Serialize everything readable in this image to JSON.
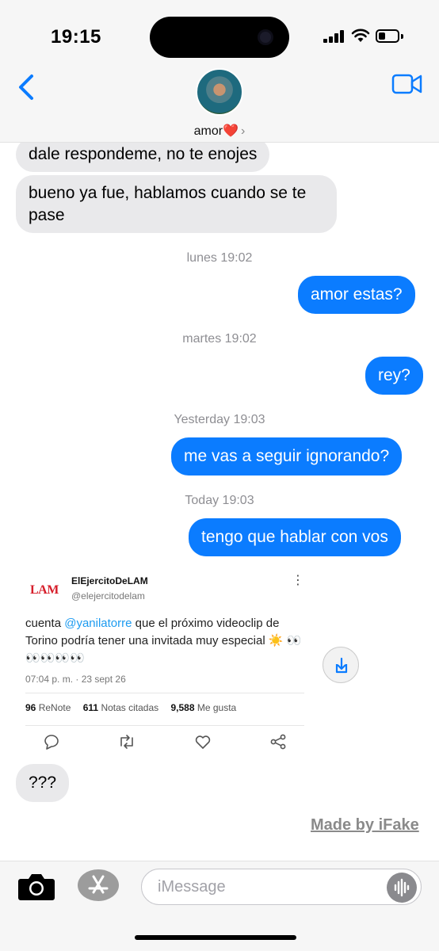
{
  "status_bar": {
    "time": "19:15",
    "battery_percent": 35
  },
  "header": {
    "contact_name": "amor❤️",
    "chevron": "›"
  },
  "messages": [
    {
      "side": "incoming",
      "text": "dale respondeme, no te enojes"
    },
    {
      "side": "incoming",
      "text": "bueno ya fue, hablamos cuando se te pase"
    },
    {
      "type": "timestamp",
      "day": "lunes",
      "time": "19:02"
    },
    {
      "side": "outgoing",
      "text": "amor estas?"
    },
    {
      "type": "timestamp",
      "day": "martes",
      "time": "19:02"
    },
    {
      "side": "outgoing",
      "text": "rey?"
    },
    {
      "type": "timestamp",
      "day": "Yesterday",
      "time": "19:03"
    },
    {
      "side": "outgoing",
      "text": "me vas a seguir ignorando?"
    },
    {
      "type": "timestamp",
      "day": "Today",
      "time": "19:03"
    },
    {
      "side": "outgoing",
      "text": "tengo que hablar con vos"
    },
    {
      "side": "incoming",
      "text": "???"
    }
  ],
  "tweet": {
    "logo": "LAM",
    "name": "ElEjercitoDeLAM",
    "handle": "@elejercitodelam",
    "more": "⋮",
    "text_before": "cuenta ",
    "mention": "@yanilatorre",
    "text_after": " que el próximo videoclip de Torino podría tener una invitada muy especial ☀️ 👀👀👀👀👀",
    "date": "07:04 p. m. · 23 sept 26",
    "renotes": "96",
    "renotes_label": "ReNote",
    "quotes": "611",
    "quotes_label": "Notas citadas",
    "likes": "9,588",
    "likes_label": "Me gusta"
  },
  "watermark": "Made by iFake",
  "input": {
    "placeholder": "iMessage",
    "value": ""
  },
  "icons": {
    "back": "chevron-left-icon",
    "video": "video-camera-icon",
    "camera": "camera-icon",
    "appstore": "app-store-icon",
    "audio": "audio-waveform-icon",
    "save": "download-icon",
    "reply": "comment-icon",
    "renote": "retweet-icon",
    "like": "heart-icon",
    "share": "share-icon"
  },
  "colors": {
    "accent": "#0b7cff",
    "incoming_bubble": "#e9e9eb",
    "tweet_link": "#1d9bf0",
    "lam_red": "#d61e2a"
  }
}
